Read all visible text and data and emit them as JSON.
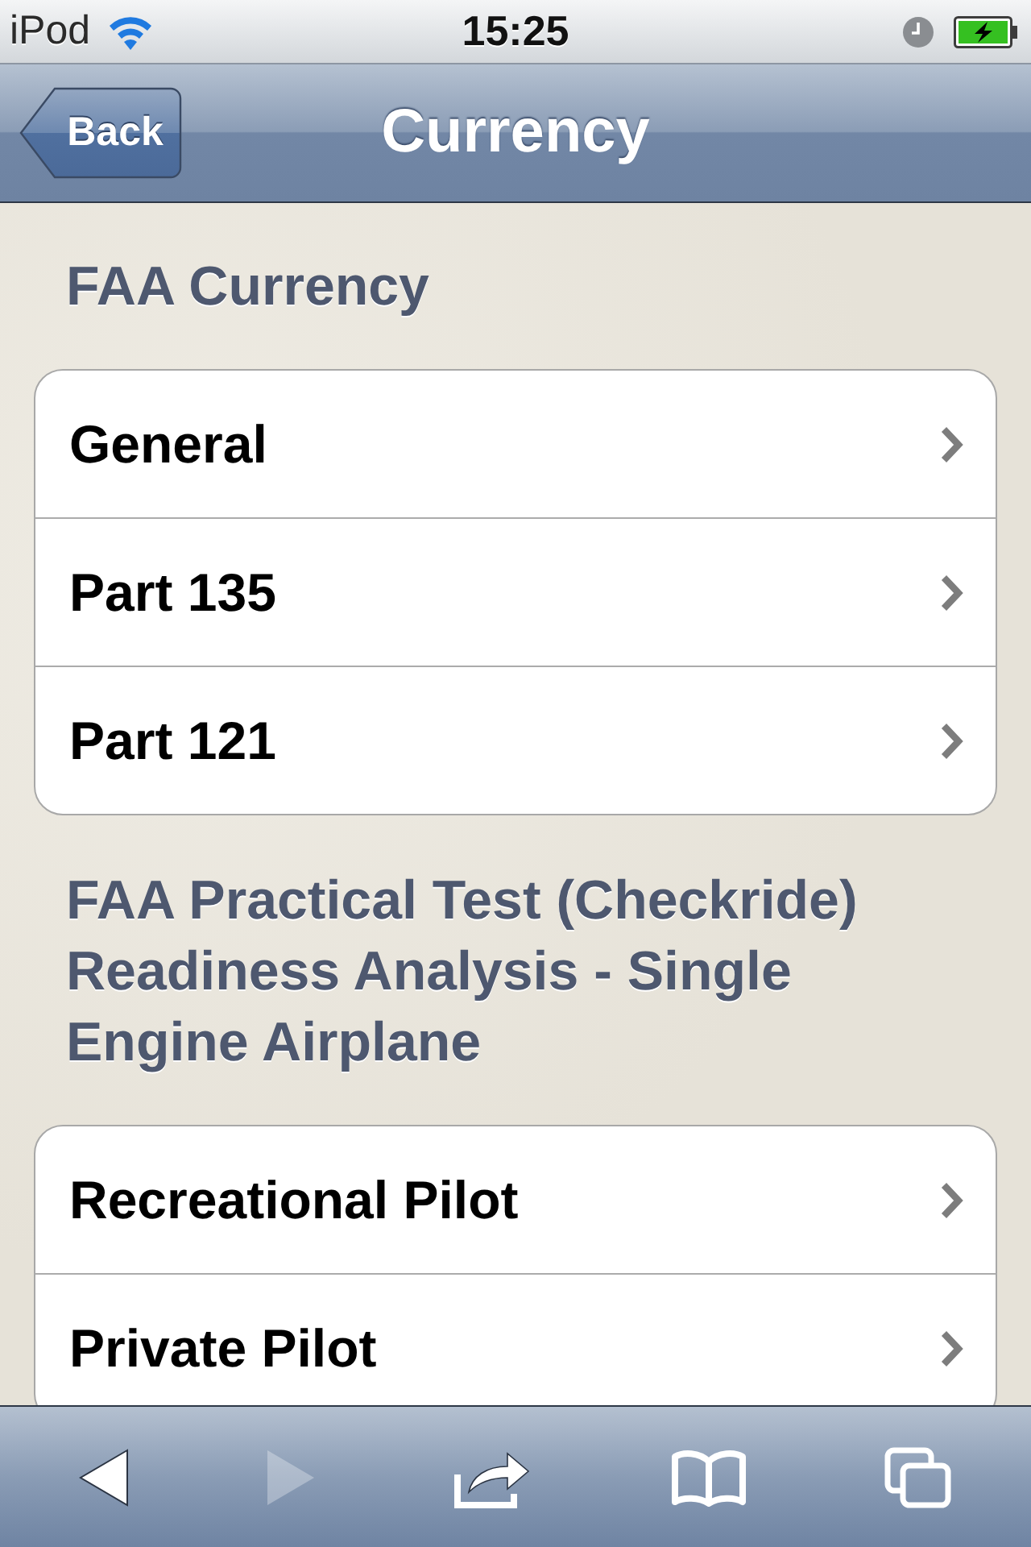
{
  "status_bar": {
    "carrier": "iPod",
    "time": "15:25"
  },
  "nav_bar": {
    "back_button": "Back",
    "title": "Currency"
  },
  "sections": [
    {
      "header": "FAA Currency",
      "items": [
        {
          "label": "General"
        },
        {
          "label": "Part 135"
        },
        {
          "label": "Part 121"
        }
      ]
    },
    {
      "header": "FAA Practical Test (Checkride) Readiness Analysis - Single Engine Airplane",
      "items": [
        {
          "label": "Recreational Pilot"
        },
        {
          "label": "Private Pilot"
        }
      ]
    }
  ],
  "toolbar": {
    "buttons": [
      {
        "kind": "back",
        "disabled": false
      },
      {
        "kind": "forward",
        "disabled": true
      },
      {
        "kind": "share",
        "disabled": false
      },
      {
        "kind": "bookmarks",
        "disabled": false
      },
      {
        "kind": "tabs",
        "disabled": false
      }
    ]
  }
}
